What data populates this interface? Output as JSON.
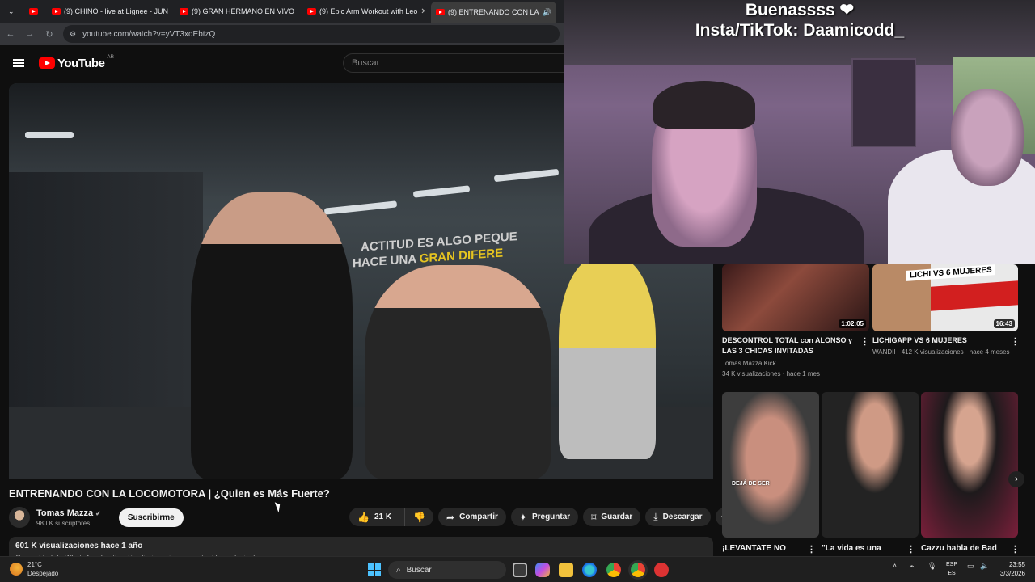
{
  "browser": {
    "tabs": [
      {
        "label": ""
      },
      {
        "label": "(9) CHINO - live at Lignee - JUN"
      },
      {
        "label": "(9) GRAN HERMANO EN VIVO"
      },
      {
        "label": "(9) Epic Arm Workout with Leo"
      },
      {
        "label": "(9) ENTRENANDO CON LA"
      }
    ],
    "url": "youtube.com/watch?v=yVT3xdEbtzQ",
    "close_glyph": "✕"
  },
  "youtube": {
    "logo_text": "YouTube",
    "country": "AR",
    "search_placeholder": "Buscar"
  },
  "video": {
    "wall_text_1": "ACTITUD ES ALGO PEQUE",
    "wall_text_2a": "HACE UNA ",
    "wall_text_2b": "GRAN DIFERE",
    "title": "ENTRENANDO CON LA LOCOMOTORA | ¿Quien es Más Fuerte?",
    "channel": "Tomas Mazza",
    "verified_glyph": "✔",
    "subscribers": "980 K suscriptores",
    "subscribe_label": "Suscribirme",
    "likes": "21 K",
    "share_label": "Compartir",
    "ask_label": "Preguntar",
    "save_label": "Guardar",
    "download_label": "Descargar",
    "description_stats": "601 K visualizaciones  hace 1 año",
    "description_preview": "Comunidad de WhatsApp (motivación diaria, avisos y contenido exclusivo):"
  },
  "webcam": {
    "line1": "Buenassss ❤",
    "line2": "Insta/TikTok: Daamicodd_"
  },
  "recommendations": [
    {
      "title": "DESCONTROL TOTAL con ALONSO y LAS 3 CHICAS  INVITADAS",
      "channel": "Tomas Mazza Kick",
      "meta": "34 K visualizaciones · hace 1 mes",
      "duration": "1:02:05"
    },
    {
      "title": "LICHIGAPP VS 6 MUJERES",
      "meta": "WANDII · 412 K visualizaciones · hace 4 meses",
      "duration": "16:43",
      "overlay": "LICHI VS 6 MUJERES"
    }
  ],
  "shorts": [
    {
      "title": "¡LEVANTATE NO",
      "overlay": "DEJÁ DE SER"
    },
    {
      "title": "\"La vida es una"
    },
    {
      "title": "Cazzu habla de Bad"
    }
  ],
  "taskbar": {
    "temperature": "21°C",
    "condition": "Despejado",
    "search_label": "Buscar",
    "lang1": "ESP",
    "lang2": "ES",
    "time": "23:55",
    "date": "3/3/2026"
  },
  "colors": {
    "accent": "#ff0000",
    "background": "#0f0f0f",
    "wall_highlight": "#e5c320"
  }
}
